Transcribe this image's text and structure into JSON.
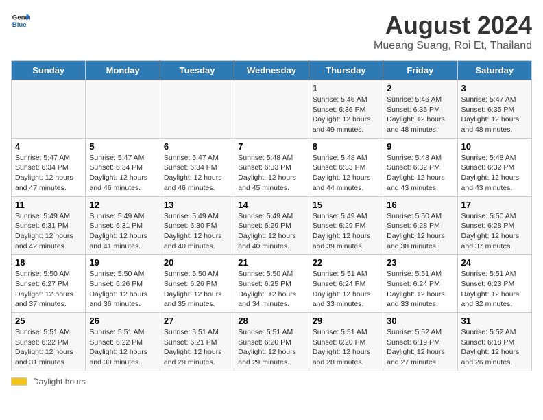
{
  "header": {
    "logo_general": "General",
    "logo_blue": "Blue",
    "title": "August 2024",
    "subtitle": "Mueang Suang, Roi Et, Thailand"
  },
  "days_of_week": [
    "Sunday",
    "Monday",
    "Tuesday",
    "Wednesday",
    "Thursday",
    "Friday",
    "Saturday"
  ],
  "weeks": [
    [
      {
        "num": "",
        "info": ""
      },
      {
        "num": "",
        "info": ""
      },
      {
        "num": "",
        "info": ""
      },
      {
        "num": "",
        "info": ""
      },
      {
        "num": "1",
        "info": "Sunrise: 5:46 AM\nSunset: 6:36 PM\nDaylight: 12 hours and 49 minutes."
      },
      {
        "num": "2",
        "info": "Sunrise: 5:46 AM\nSunset: 6:35 PM\nDaylight: 12 hours and 48 minutes."
      },
      {
        "num": "3",
        "info": "Sunrise: 5:47 AM\nSunset: 6:35 PM\nDaylight: 12 hours and 48 minutes."
      }
    ],
    [
      {
        "num": "4",
        "info": "Sunrise: 5:47 AM\nSunset: 6:34 PM\nDaylight: 12 hours and 47 minutes."
      },
      {
        "num": "5",
        "info": "Sunrise: 5:47 AM\nSunset: 6:34 PM\nDaylight: 12 hours and 46 minutes."
      },
      {
        "num": "6",
        "info": "Sunrise: 5:47 AM\nSunset: 6:34 PM\nDaylight: 12 hours and 46 minutes."
      },
      {
        "num": "7",
        "info": "Sunrise: 5:48 AM\nSunset: 6:33 PM\nDaylight: 12 hours and 45 minutes."
      },
      {
        "num": "8",
        "info": "Sunrise: 5:48 AM\nSunset: 6:33 PM\nDaylight: 12 hours and 44 minutes."
      },
      {
        "num": "9",
        "info": "Sunrise: 5:48 AM\nSunset: 6:32 PM\nDaylight: 12 hours and 43 minutes."
      },
      {
        "num": "10",
        "info": "Sunrise: 5:48 AM\nSunset: 6:32 PM\nDaylight: 12 hours and 43 minutes."
      }
    ],
    [
      {
        "num": "11",
        "info": "Sunrise: 5:49 AM\nSunset: 6:31 PM\nDaylight: 12 hours and 42 minutes."
      },
      {
        "num": "12",
        "info": "Sunrise: 5:49 AM\nSunset: 6:31 PM\nDaylight: 12 hours and 41 minutes."
      },
      {
        "num": "13",
        "info": "Sunrise: 5:49 AM\nSunset: 6:30 PM\nDaylight: 12 hours and 40 minutes."
      },
      {
        "num": "14",
        "info": "Sunrise: 5:49 AM\nSunset: 6:29 PM\nDaylight: 12 hours and 40 minutes."
      },
      {
        "num": "15",
        "info": "Sunrise: 5:49 AM\nSunset: 6:29 PM\nDaylight: 12 hours and 39 minutes."
      },
      {
        "num": "16",
        "info": "Sunrise: 5:50 AM\nSunset: 6:28 PM\nDaylight: 12 hours and 38 minutes."
      },
      {
        "num": "17",
        "info": "Sunrise: 5:50 AM\nSunset: 6:28 PM\nDaylight: 12 hours and 37 minutes."
      }
    ],
    [
      {
        "num": "18",
        "info": "Sunrise: 5:50 AM\nSunset: 6:27 PM\nDaylight: 12 hours and 37 minutes."
      },
      {
        "num": "19",
        "info": "Sunrise: 5:50 AM\nSunset: 6:26 PM\nDaylight: 12 hours and 36 minutes."
      },
      {
        "num": "20",
        "info": "Sunrise: 5:50 AM\nSunset: 6:26 PM\nDaylight: 12 hours and 35 minutes."
      },
      {
        "num": "21",
        "info": "Sunrise: 5:50 AM\nSunset: 6:25 PM\nDaylight: 12 hours and 34 minutes."
      },
      {
        "num": "22",
        "info": "Sunrise: 5:51 AM\nSunset: 6:24 PM\nDaylight: 12 hours and 33 minutes."
      },
      {
        "num": "23",
        "info": "Sunrise: 5:51 AM\nSunset: 6:24 PM\nDaylight: 12 hours and 33 minutes."
      },
      {
        "num": "24",
        "info": "Sunrise: 5:51 AM\nSunset: 6:23 PM\nDaylight: 12 hours and 32 minutes."
      }
    ],
    [
      {
        "num": "25",
        "info": "Sunrise: 5:51 AM\nSunset: 6:22 PM\nDaylight: 12 hours and 31 minutes."
      },
      {
        "num": "26",
        "info": "Sunrise: 5:51 AM\nSunset: 6:22 PM\nDaylight: 12 hours and 30 minutes."
      },
      {
        "num": "27",
        "info": "Sunrise: 5:51 AM\nSunset: 6:21 PM\nDaylight: 12 hours and 29 minutes."
      },
      {
        "num": "28",
        "info": "Sunrise: 5:51 AM\nSunset: 6:20 PM\nDaylight: 12 hours and 29 minutes."
      },
      {
        "num": "29",
        "info": "Sunrise: 5:51 AM\nSunset: 6:20 PM\nDaylight: 12 hours and 28 minutes."
      },
      {
        "num": "30",
        "info": "Sunrise: 5:52 AM\nSunset: 6:19 PM\nDaylight: 12 hours and 27 minutes."
      },
      {
        "num": "31",
        "info": "Sunrise: 5:52 AM\nSunset: 6:18 PM\nDaylight: 12 hours and 26 minutes."
      }
    ]
  ],
  "footer": {
    "daylight_label": "Daylight hours"
  }
}
